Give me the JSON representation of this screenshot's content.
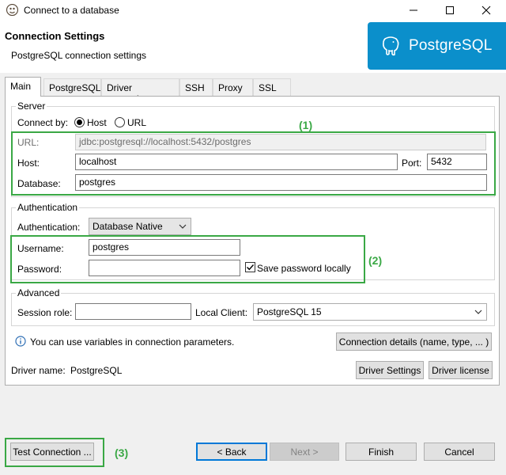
{
  "window": {
    "title": "Connect to a database"
  },
  "header": {
    "title": "Connection Settings",
    "subtitle": "PostgreSQL connection settings",
    "logo_text": "PostgreSQL",
    "logo_color": "#0b8fcb"
  },
  "tabs": [
    {
      "label": "Main",
      "active": true
    },
    {
      "label": "PostgreSQL"
    },
    {
      "label": "Driver properties"
    },
    {
      "label": "SSH"
    },
    {
      "label": "Proxy"
    },
    {
      "label": "SSL"
    }
  ],
  "server": {
    "group_label": "Server",
    "connect_by_label": "Connect by:",
    "option_host": "Host",
    "option_url": "URL",
    "selected": "Host",
    "url_label": "URL:",
    "url_value": "jdbc:postgresql://localhost:5432/postgres",
    "host_label": "Host:",
    "host_value": "localhost",
    "port_label": "Port:",
    "port_value": "5432",
    "database_label": "Database:",
    "database_value": "postgres"
  },
  "auth": {
    "group_label": "Authentication",
    "auth_label": "Authentication:",
    "auth_value": "Database Native",
    "username_label": "Username:",
    "username_value": "postgres",
    "password_label": "Password:",
    "password_value": "",
    "save_password_label": "Save password locally",
    "save_password_checked": true
  },
  "advanced": {
    "group_label": "Advanced",
    "session_role_label": "Session role:",
    "session_role_value": "",
    "local_client_label": "Local Client:",
    "local_client_value": "PostgreSQL 15"
  },
  "info": {
    "text": "You can use variables in connection parameters.",
    "details_button": "Connection details (name, type, ... )"
  },
  "driver": {
    "label": "Driver name:",
    "value": "PostgreSQL",
    "settings_button": "Driver Settings",
    "license_button": "Driver license"
  },
  "annotations": {
    "a1": "(1)",
    "a2": "(2)",
    "a3": "(3)",
    "color": "#3aa845"
  },
  "footer": {
    "test_button": "Test Connection ...",
    "back_button": "< Back",
    "next_button": "Next >",
    "finish_button": "Finish",
    "cancel_button": "Cancel"
  }
}
